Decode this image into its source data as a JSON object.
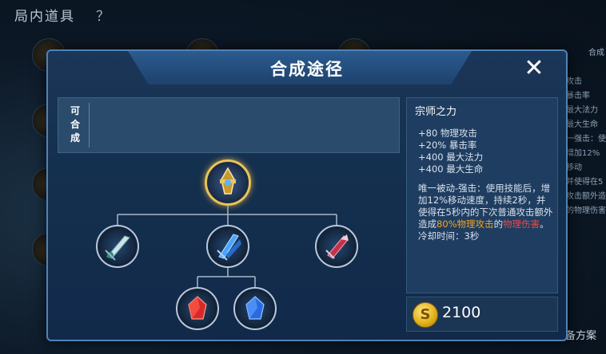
{
  "background": {
    "title": "局内道具",
    "help": "？",
    "side_top": "合成",
    "side_lines": [
      "攻击",
      "暴击率",
      "最大法力",
      "最大生命",
      "一强击：使",
      "增加12%移动",
      "并使得在5",
      "攻击额外造",
      "的物理伤害"
    ],
    "bottom_label": "装备方案"
  },
  "dialog": {
    "title": "合成途径",
    "close_icon": "close-icon",
    "craftable_label": "可合成",
    "tree": {
      "root": {
        "icon": "master-force-icon"
      },
      "children": [
        {
          "icon": "iron-sword-icon"
        },
        {
          "icon": "blue-blade-icon"
        },
        {
          "icon": "red-shard-icon"
        }
      ],
      "grandchildren": [
        {
          "icon": "red-crystal-icon"
        },
        {
          "icon": "blue-crystal-icon"
        }
      ]
    },
    "item": {
      "name": "宗师之力",
      "stats": [
        "+80 物理攻击",
        "+20% 暴击率",
        "+400 最大法力",
        "+400 最大生命"
      ],
      "passive_1": "唯一被动-强击：使用技能后，增加12%移动速度，持续2秒，并使得在5秒内的下次普通攻击额外造成",
      "passive_highlight": "80%物理攻击",
      "passive_2": "的",
      "passive_damage": "物理伤害",
      "passive_3": "。冷却时间：3秒",
      "price": "2100",
      "coin_icon": "gold-coin-icon"
    },
    "colors": {
      "accent": "#4f82b8",
      "orange": "#f3a425",
      "red": "#ef4a4a",
      "gold": "#e8c45a"
    }
  }
}
